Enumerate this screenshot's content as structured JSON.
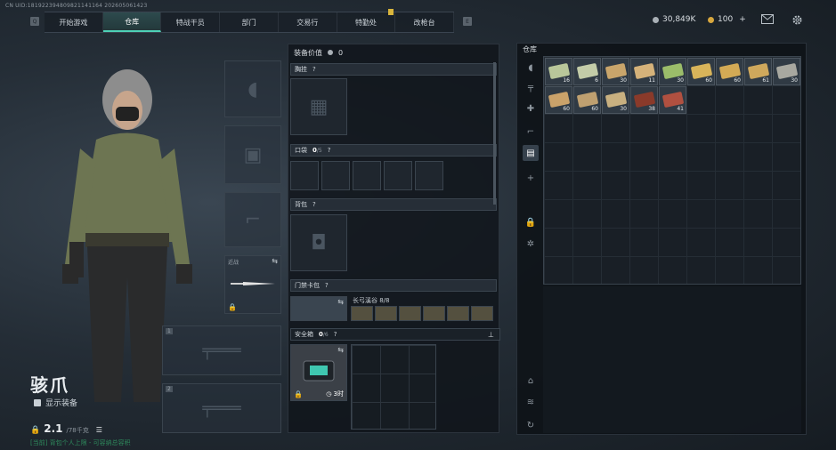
{
  "uid": "CN UID:181922394809821141164 2026050614​23",
  "nav": {
    "left_key": "Q",
    "right_key": "E",
    "tabs": [
      "开始游戏",
      "仓库",
      "特战干员",
      "部门",
      "交易行",
      "特勤处",
      "改枪台"
    ],
    "active_index": 1
  },
  "currency": {
    "silver": "30,849K",
    "gold": "100",
    "gold_add": "+"
  },
  "icons": {
    "mail": "mail-icon",
    "settings": "gear-icon"
  },
  "operator": {
    "name": "骇爪",
    "show_equipment_label": "显示装备",
    "weight": "2.1",
    "weight_unit": "/78千克",
    "hint": "[当前] 背包个人上限 - 可容纳总容积"
  },
  "loadout": {
    "value_label": "装备价值",
    "value": "0",
    "chest_label": "胸挂",
    "chest_q": "?",
    "pocket_label": "口袋",
    "pocket_count": "0",
    "pocket_cap": "/5",
    "pocket_q": "?",
    "backpack_label": "背包",
    "backpack_q": "?",
    "keycard_label": "门禁卡包",
    "keycard_q": "?",
    "keycard_item": "长弓溪谷 8/8",
    "safebox_label": "安全箱",
    "safebox_count": "0",
    "safebox_cap": "/6",
    "safebox_q": "?",
    "safebox_time": "3时"
  },
  "melee_label": "近战",
  "weapon_slots": [
    "1",
    "2"
  ],
  "warehouse": {
    "title": "仓库",
    "items": [
      {
        "count": "16",
        "color": "#b9c79a"
      },
      {
        "count": "6",
        "color": "#c3cca8"
      },
      {
        "count": "30",
        "color": "#c9a56b"
      },
      {
        "count": "11",
        "color": "#d5b27a"
      },
      {
        "count": "30",
        "color": "#9bbd6a"
      },
      {
        "count": "60",
        "color": "#d8b45a"
      },
      {
        "count": "60",
        "color": "#d3aa55"
      },
      {
        "count": "61",
        "color": "#cfa85c"
      },
      {
        "count": "30",
        "color": "#a8a8a0"
      },
      {
        "count": "60",
        "color": "#caa26a"
      },
      {
        "count": "60",
        "color": "#bfa070"
      },
      {
        "count": "30",
        "color": "#c8b080"
      },
      {
        "count": "38",
        "color": "#8a3a2a"
      },
      {
        "count": "41",
        "color": "#b05040"
      }
    ]
  }
}
